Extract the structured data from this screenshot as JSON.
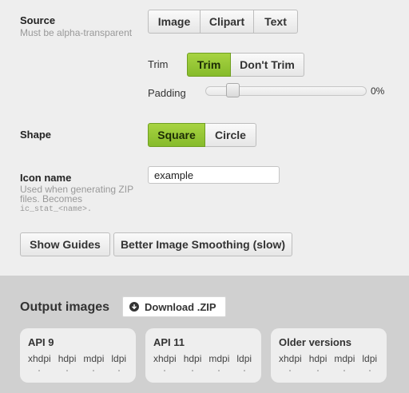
{
  "source": {
    "title": "Source",
    "help": "Must be alpha-transparent",
    "options": [
      {
        "label": "Image",
        "active": false
      },
      {
        "label": "Clipart",
        "active": false
      },
      {
        "label": "Text",
        "active": false
      }
    ]
  },
  "trim": {
    "label": "Trim",
    "options": [
      {
        "label": "Trim",
        "active": true
      },
      {
        "label": "Don't Trim",
        "active": false
      }
    ]
  },
  "padding": {
    "label": "Padding",
    "value_text": "0%",
    "value_fraction": 0.0
  },
  "shape": {
    "title": "Shape",
    "options": [
      {
        "label": "Square",
        "active": true
      },
      {
        "label": "Circle",
        "active": false
      }
    ]
  },
  "icon_name": {
    "title": "Icon name",
    "help_line1": "Used when generating ZIP",
    "help_line2": "files. Becomes",
    "help_code": "ic_stat_<name>.",
    "value": "example"
  },
  "toggles": {
    "show_guides": "Show Guides",
    "smoothing": "Better Image Smoothing (slow)"
  },
  "output": {
    "title": "Output images",
    "download_label": "Download .ZIP",
    "cards": [
      {
        "title": "API 9",
        "dpis": [
          "xhdpi",
          "hdpi",
          "mdpi",
          "ldpi"
        ]
      },
      {
        "title": "API 11",
        "dpis": [
          "xhdpi",
          "hdpi",
          "mdpi",
          "ldpi"
        ]
      },
      {
        "title": "Older versions",
        "dpis": [
          "xhdpi",
          "hdpi",
          "mdpi",
          "ldpi"
        ]
      }
    ]
  },
  "colors": {
    "active_green": "#94c535",
    "panel_light": "#eeeeee",
    "panel_dark": "#d0d0d0"
  }
}
